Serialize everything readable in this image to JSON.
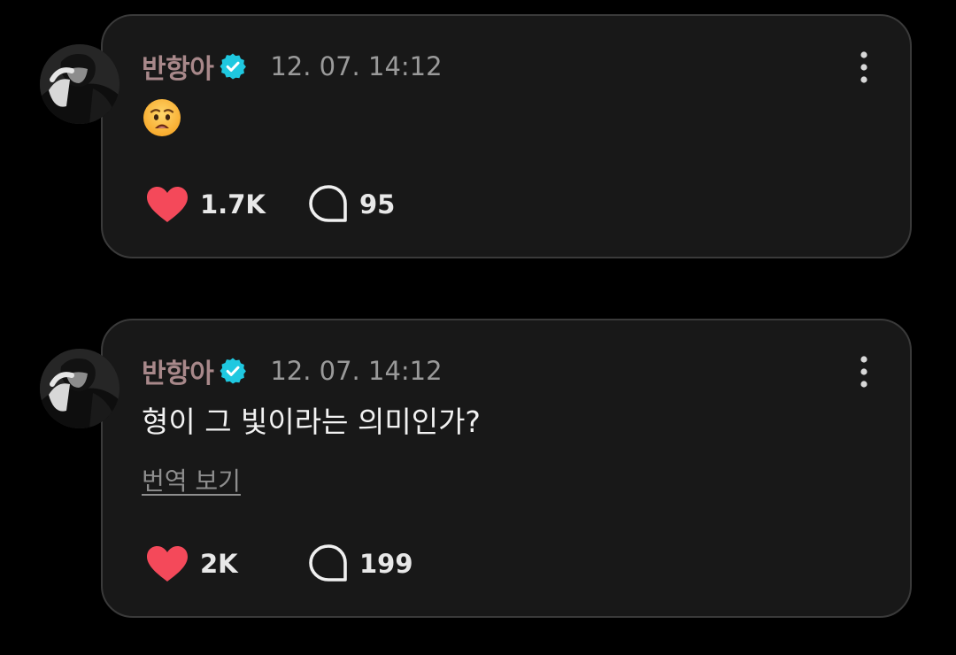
{
  "colors": {
    "background": "#000000",
    "card": "#181818",
    "card_border": "#3a3a3a",
    "username": "#a8888a",
    "verified": "#1fc8e0",
    "heart": "#f4495a",
    "text": "#f2f2f2",
    "muted": "#9a9a9a"
  },
  "posts": [
    {
      "username": "반항아",
      "verified_icon": "verified-badge-icon",
      "timestamp": "12. 07. 14:12",
      "content_emoji": "anguished-face-emoji",
      "likes": "1.7K",
      "replies": "95"
    },
    {
      "username": "반항아",
      "verified_icon": "verified-badge-icon",
      "timestamp": "12. 07. 14:12",
      "text": "형이 그 빛이라는 의미인가?",
      "translate_label": "번역 보기",
      "likes": "2K",
      "replies": "199"
    }
  ]
}
